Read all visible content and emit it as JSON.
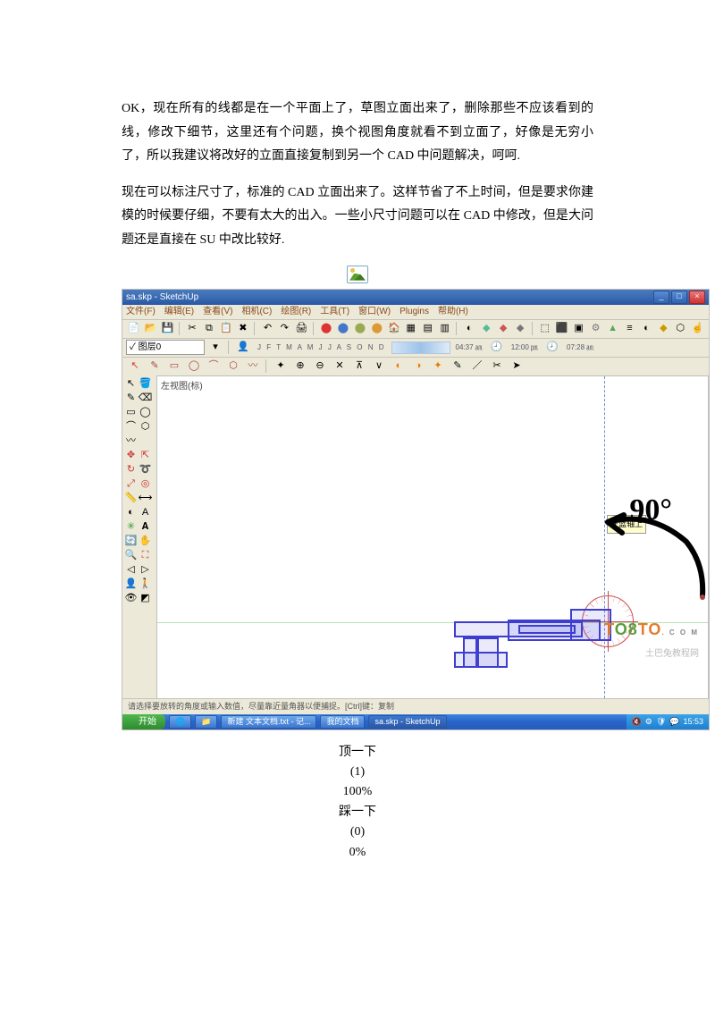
{
  "article": {
    "p1": "OK，现在所有的线都是在一个平面上了，草图立面出来了，删除那些不应该看到的线，修改下细节，这里还有个问题，换个视图角度就看不到立面了，好像是无穷小了，所以我建议将改好的立面直接复制到另一个 CAD 中问题解决，呵呵.",
    "p2": "现在可以标注尺寸了，标准的 CAD 立面出来了。这样节省了不上时间，但是要求你建模的时候要仔细，不要有太大的出入。一些小尺寸问题可以在 CAD 中修改，但是大问题还是直接在 SU 中改比较好."
  },
  "screenshot": {
    "title": "sa.skp - SketchUp",
    "menu": [
      "文件(F)",
      "编辑(E)",
      "查看(V)",
      "相机(C)",
      "绘图(R)",
      "工具(T)",
      "窗口(W)",
      "Plugins",
      "帮助(H)"
    ],
    "layer_label": "✓ 图层0",
    "view_label": "左视图(标)",
    "hint_text": "在蓝轴上",
    "annotation": "90°",
    "status_text": "请选择要放转的角度或输入数值，尽量靠近量角器以便捕捉。[Ctrl]键：复制",
    "taskbar": {
      "start": "开始",
      "items": [
        "新建 文本文档.txt - 记...",
        "我的文档",
        "sa.skp - SketchUp"
      ],
      "time": "15:53"
    },
    "months_strip": "J F T M A M J J A S O N D",
    "time_strip1": "04:37 ㏂",
    "time_strip2": "12:00 ㏘",
    "time_strip3": "07:28 ㏂",
    "watermark": {
      "brand_t": "T",
      "brand_o8": "O8",
      "brand_to": "TO",
      "dotcom": ". C O M",
      "cn": "土巴兔教程网"
    }
  },
  "vote": {
    "up_label": "顶一下",
    "up_count": "(1)",
    "up_pct": "100%",
    "down_label": "踩一下",
    "down_count": "(0)",
    "down_pct": "0%"
  }
}
